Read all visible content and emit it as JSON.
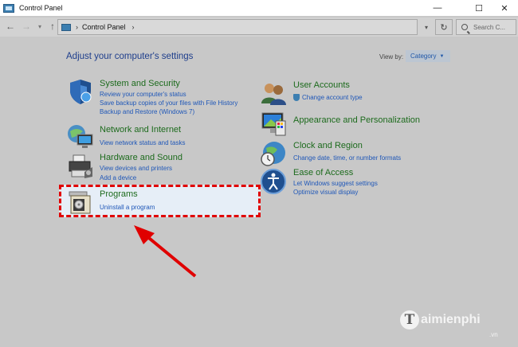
{
  "window": {
    "title": "Control Panel",
    "minimize": "—",
    "maximize": "☐",
    "close": "✕"
  },
  "address": {
    "back": "←",
    "forward": "→",
    "history": "▾",
    "up": "↑",
    "sep": "›",
    "path": "Control Panel",
    "sep2": "›",
    "dropdown": "▾",
    "refresh": "↻",
    "search_placeholder": "Search C..."
  },
  "main": {
    "heading": "Adjust your computer's settings",
    "view_by_label": "View by:",
    "view_by_value": "Category",
    "view_by_arrow": "▼"
  },
  "categories_left": [
    {
      "title": "System and Security",
      "links": [
        "Review your computer's status",
        "Save backup copies of your files with File History",
        "Backup and Restore (Windows 7)"
      ]
    },
    {
      "title": "Network and Internet",
      "links": [
        "View network status and tasks"
      ]
    },
    {
      "title": "Hardware and Sound",
      "links": [
        "View devices and printers",
        "Add a device"
      ]
    },
    {
      "title": "Programs",
      "links": [
        "Uninstall a program"
      ]
    }
  ],
  "categories_right": [
    {
      "title": "User Accounts",
      "links": [
        "Change account type"
      ]
    },
    {
      "title": "Appearance and Personalization",
      "links": []
    },
    {
      "title": "Clock and Region",
      "links": [
        "Change date, time, or number formats"
      ]
    },
    {
      "title": "Ease of Access",
      "links": [
        "Let Windows suggest settings",
        "Optimize visual display"
      ]
    }
  ],
  "watermark": {
    "letter": "T",
    "name": "aimienphi",
    "domain": ".vn"
  },
  "colors": {
    "heading": "#1e3e8c",
    "category_title": "#1d6b1d",
    "link": "#1f57b8",
    "highlight_border": "#e00000",
    "arrow": "#e00000"
  },
  "icons": [
    "control-panel-icon",
    "shield-icon",
    "network-icon",
    "printer-icon",
    "programs-icon",
    "users-icon",
    "appearance-icon",
    "clock-globe-icon",
    "ease-of-access-icon",
    "search-icon"
  ]
}
